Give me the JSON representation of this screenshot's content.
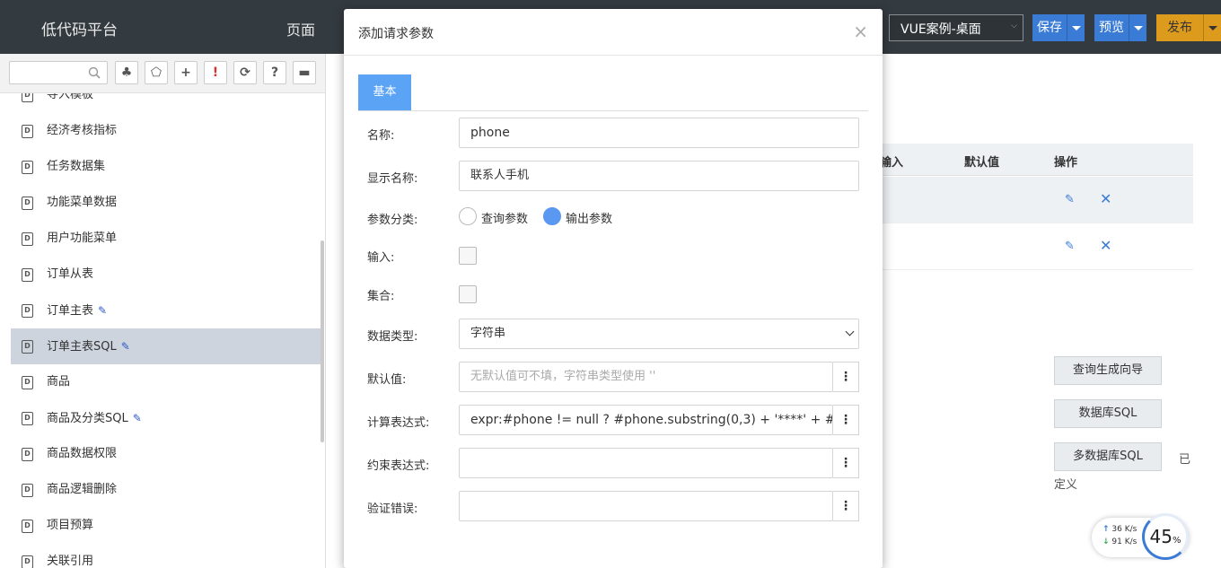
{
  "topbar": {
    "brand": "低代码平台",
    "nav_page": "页面",
    "project_select": "VUE案例-桌面",
    "save_label": "保存",
    "preview_label": "预览",
    "publish_label": "发布"
  },
  "sidebar": {
    "items": [
      {
        "label": "导入模板",
        "edited": false
      },
      {
        "label": "经济考核指标",
        "edited": false
      },
      {
        "label": "任务数据集",
        "edited": false
      },
      {
        "label": "功能菜单数据",
        "edited": false
      },
      {
        "label": "用户功能菜单",
        "edited": false
      },
      {
        "label": "订单从表",
        "edited": false
      },
      {
        "label": "订单主表",
        "edited": true
      },
      {
        "label": "订单主表SQL",
        "edited": true,
        "selected": true
      },
      {
        "label": "商品",
        "edited": false
      },
      {
        "label": "商品及分类SQL",
        "edited": true
      },
      {
        "label": "商品数据权限",
        "edited": false
      },
      {
        "label": "商品逻辑删除",
        "edited": false
      },
      {
        "label": "项目预算",
        "edited": false
      },
      {
        "label": "关联引用",
        "edited": false
      }
    ]
  },
  "background": {
    "columns": [
      "输入",
      "默认值",
      "操作"
    ],
    "buttons": [
      "查询生成向导",
      "数据库SQL",
      "多数据库SQL"
    ],
    "note_part1": "已",
    "note_part2": "定义"
  },
  "speed_widget": {
    "up": "36 K/s",
    "down": "91 K/s",
    "percent": "45",
    "percent_unit": "%"
  },
  "modal": {
    "title": "添加请求参数",
    "tab": "基本",
    "fields": {
      "name_label": "名称:",
      "name_value": "phone",
      "display_label": "显示名称:",
      "display_value": "联系人手机",
      "category_label": "参数分类:",
      "category_options": [
        "查询参数",
        "输出参数"
      ],
      "category_selected": "输出参数",
      "input_label": "输入:",
      "collection_label": "集合:",
      "datatype_label": "数据类型:",
      "datatype_value": "字符串",
      "default_label": "默认值:",
      "default_placeholder": "无默认值可不填，字符串类型使用 ''",
      "expr_label": "计算表达式:",
      "expr_value": "expr:#phone != null ? #phone.substring(0,3) + '****' + #ph",
      "constraint_label": "约束表达式:",
      "constraint_value": "",
      "validation_label": "验证错误:",
      "validation_value": ""
    }
  }
}
